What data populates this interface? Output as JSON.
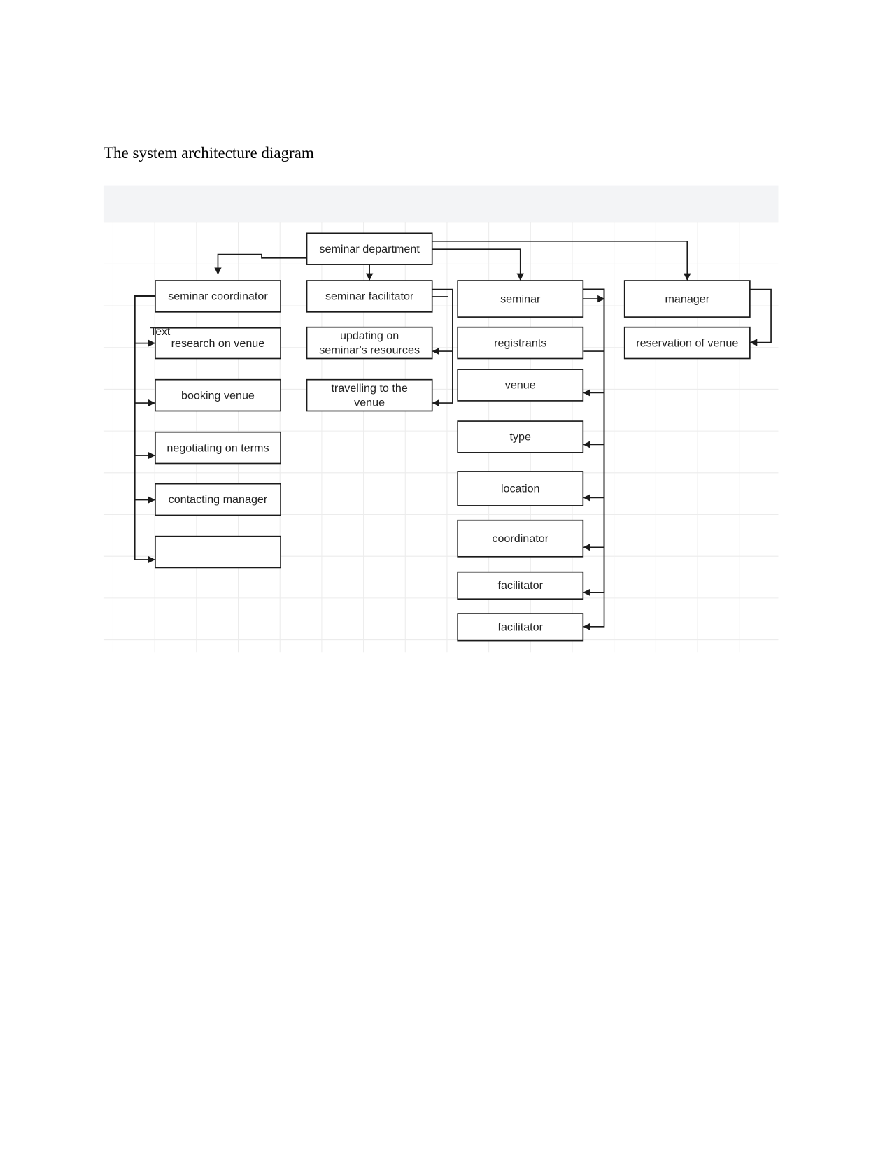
{
  "document": {
    "title": "The system architecture diagram"
  },
  "diagram": {
    "colors": {
      "stroke": "#1a1a1a",
      "grid": "#ececec",
      "header_band": "#f3f4f6",
      "box_fill": "#ffffff"
    },
    "stray_label": "Text",
    "nodes": [
      {
        "id": "dept",
        "lines": [
          "seminar department"
        ]
      },
      {
        "id": "coord",
        "lines": [
          "seminar coordinator"
        ]
      },
      {
        "id": "research",
        "lines": [
          "research on venue"
        ]
      },
      {
        "id": "booking",
        "lines": [
          "booking venue"
        ]
      },
      {
        "id": "negotiating",
        "lines": [
          "negotiating on terms"
        ]
      },
      {
        "id": "contacting",
        "lines": [
          "contacting manager"
        ]
      },
      {
        "id": "empty",
        "lines": []
      },
      {
        "id": "facil",
        "lines": [
          "seminar facilitator"
        ]
      },
      {
        "id": "updating",
        "lines": [
          "updating on",
          "seminar's resources"
        ]
      },
      {
        "id": "travelling",
        "lines": [
          "travelling to the",
          "venue"
        ]
      },
      {
        "id": "seminar",
        "lines": [
          "seminar"
        ]
      },
      {
        "id": "registrants",
        "lines": [
          "registrants"
        ]
      },
      {
        "id": "venue",
        "lines": [
          "venue"
        ]
      },
      {
        "id": "type",
        "lines": [
          "type"
        ]
      },
      {
        "id": "location",
        "lines": [
          "location"
        ]
      },
      {
        "id": "coordinator",
        "lines": [
          "coordinator"
        ]
      },
      {
        "id": "facilitator1",
        "lines": [
          "facilitator"
        ]
      },
      {
        "id": "facilitator2",
        "lines": [
          "facilitator"
        ]
      },
      {
        "id": "manager",
        "lines": [
          "manager"
        ]
      },
      {
        "id": "reservation",
        "lines": [
          "reservation of venue"
        ]
      }
    ],
    "edges": [
      {
        "from": "dept",
        "to": "coord"
      },
      {
        "from": "dept",
        "to": "facil"
      },
      {
        "from": "dept",
        "to": "seminar"
      },
      {
        "from": "dept",
        "to": "manager"
      },
      {
        "from": "coord",
        "to": "research"
      },
      {
        "from": "coord",
        "to": "booking"
      },
      {
        "from": "coord",
        "to": "negotiating"
      },
      {
        "from": "coord",
        "to": "contacting"
      },
      {
        "from": "coord",
        "to": "empty"
      },
      {
        "from": "facil",
        "to": "updating"
      },
      {
        "from": "facil",
        "to": "travelling"
      },
      {
        "from": "seminar",
        "to": "registrants"
      },
      {
        "from": "seminar",
        "to": "venue"
      },
      {
        "from": "seminar",
        "to": "type"
      },
      {
        "from": "seminar",
        "to": "location"
      },
      {
        "from": "seminar",
        "to": "coordinator"
      },
      {
        "from": "seminar",
        "to": "facilitator1"
      },
      {
        "from": "seminar",
        "to": "facilitator2"
      },
      {
        "from": "manager",
        "to": "reservation"
      }
    ]
  }
}
